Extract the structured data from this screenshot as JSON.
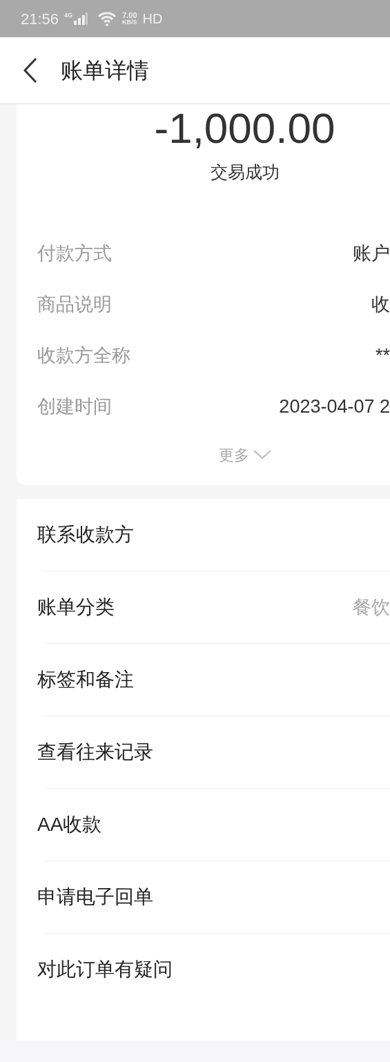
{
  "status_bar": {
    "time": "21:56",
    "network": "4G",
    "speed": "7.00",
    "speed_unit": "KB/S",
    "hd": "HD"
  },
  "header": {
    "title": "账单详情"
  },
  "summary": {
    "amount": "-1,000.00",
    "status": "交易成功",
    "details": [
      {
        "label": "付款方式",
        "value": "账户"
      },
      {
        "label": "商品说明",
        "value": "收"
      },
      {
        "label": "收款方全称",
        "value": "**"
      },
      {
        "label": "创建时间",
        "value": "2023-04-07 2"
      }
    ],
    "more": "更多"
  },
  "actions": [
    {
      "label": "联系收款方"
    },
    {
      "label": "账单分类",
      "value": "餐饮"
    },
    {
      "label": "标签和备注"
    },
    {
      "label": "查看往来记录"
    },
    {
      "label": "AA收款"
    },
    {
      "label": "申请电子回单"
    },
    {
      "label": "对此订单有疑问"
    }
  ]
}
